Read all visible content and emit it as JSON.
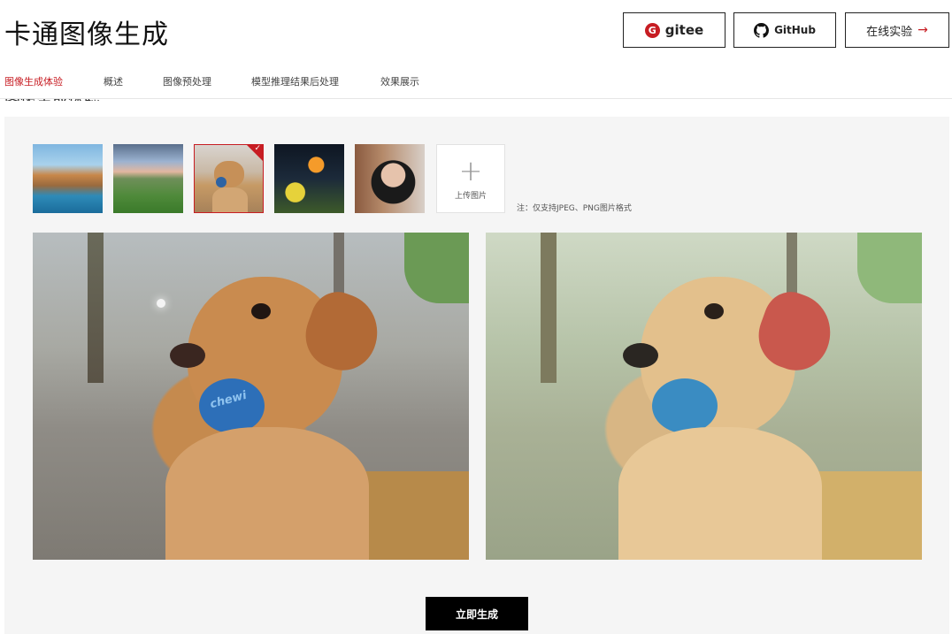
{
  "header": {
    "title": "卡通图像生成",
    "buttons": {
      "gitee": "gitee",
      "github": "GitHub",
      "online": "在线实验",
      "online_arrow": "→"
    }
  },
  "nav": {
    "items": [
      {
        "label": "图像生成体验",
        "active": true
      },
      {
        "label": "概述",
        "active": false
      },
      {
        "label": "图像预处理",
        "active": false
      },
      {
        "label": "模型推理结果后处理",
        "active": false
      },
      {
        "label": "效果展示",
        "active": false
      }
    ]
  },
  "section": {
    "title": "图像生成体验"
  },
  "thumbnails": [
    {
      "subject": "coastal-town"
    },
    {
      "subject": "flower-field"
    },
    {
      "subject": "golden-retriever",
      "selected": true
    },
    {
      "subject": "butterfly-flowers"
    },
    {
      "subject": "portrait-woman"
    }
  ],
  "upload": {
    "icon": "+",
    "label": "上传图片"
  },
  "note": "注：仅支持JPEG、PNG图片格式",
  "ball_text": "chewi",
  "check_mark": "✓",
  "generate_button": "立即生成",
  "colors": {
    "accent": "#c71d23",
    "button_bg": "#000000",
    "panel_bg": "#f5f5f5"
  }
}
